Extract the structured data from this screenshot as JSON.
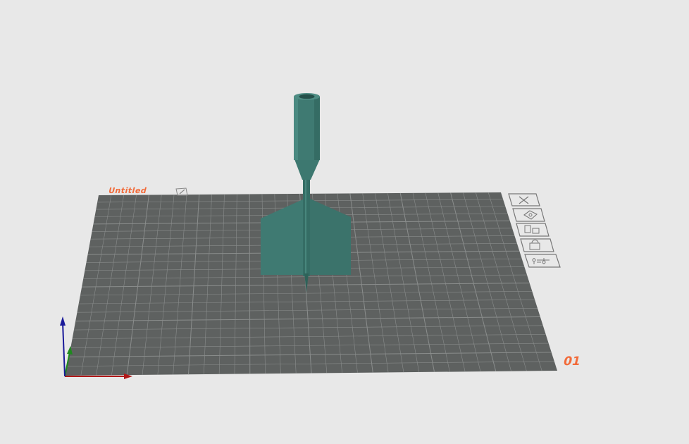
{
  "plate": {
    "name": "Untitled",
    "number": "01",
    "surface_color": "#5e6160",
    "accent_color": "#f26b3a"
  },
  "model": {
    "color": "#3f7a72"
  },
  "plate_tools": [
    {
      "name": "close-icon"
    },
    {
      "name": "auto-orient-icon"
    },
    {
      "name": "arrange-icon"
    },
    {
      "name": "lock-icon"
    },
    {
      "name": "plate-settings-icon"
    }
  ],
  "axes": {
    "x_color": "#b01818",
    "y_color": "#1e8a1e",
    "z_color": "#1a1a9a"
  }
}
